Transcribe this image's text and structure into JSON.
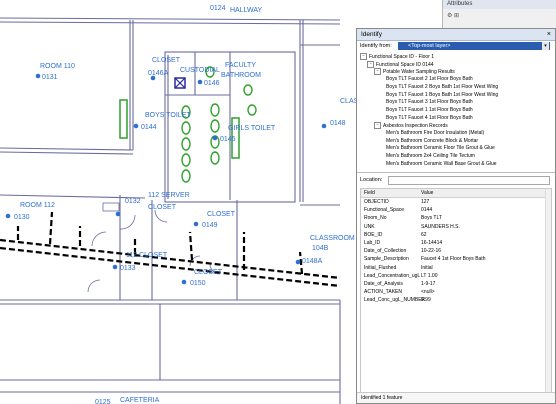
{
  "map": {
    "rooms": {
      "hallway_num": "0124",
      "hallway": "HALLWAY",
      "room110": "ROOM 110",
      "room110_num": "0131",
      "closet_a": "CLOSET",
      "closet_a_num": "0146A",
      "custodial": "CUSTODIAL",
      "faculty": "FACULTY",
      "bathroom": "BATHROOM",
      "bathroom_num": "0146",
      "boys_toilet": "BOYS TOILET",
      "boys_num": "0144",
      "girls_toilet": "GIRLS TOILET",
      "girls_num": "0145",
      "class_right": "CLASS",
      "class_right_num": "0148",
      "room112": "ROOM 112",
      "room112_num": "0130",
      "num0132": "0132",
      "server1": "112 SERVER",
      "server2": "CLOSET",
      "closet_b": "CLOSET",
      "closet_b_num": "0149",
      "closet_112": "112 CLOSET",
      "num0133": "0133",
      "closet_c": "CLOSET",
      "closet_c_num": "0150",
      "classroom": "CLASSROOM",
      "classroom_num": "104B",
      "classroom_num2": "0148A",
      "cafeteria": "CAFETERIA",
      "cafeteria_num": "0125"
    },
    "colors": {
      "walls": "#6b6b9e",
      "labels": "#2f6fd0",
      "plumbing": "#2ca02c",
      "pipe": "#000000"
    }
  },
  "attributes_panel": {
    "title": "Attributes",
    "toolbar": "⚙ ⊞"
  },
  "identify": {
    "title": "Identify",
    "close": "×",
    "from_label": "Identify from:",
    "from_value": "<Top-most layer>",
    "tree": [
      {
        "level": 0,
        "toggle": "−",
        "label": "Functional Space ID - Floor 1"
      },
      {
        "level": 1,
        "toggle": "−",
        "label": "Functional Space ID 0144"
      },
      {
        "level": 2,
        "toggle": "−",
        "label": "Potable Water Sampling Results"
      },
      {
        "level": 3,
        "toggle": "",
        "label": "Boys TLT Faucet 2 1st Floor Boys Bath"
      },
      {
        "level": 3,
        "toggle": "",
        "label": "Boys TLT Faucet 2 Boys Bath 1st Floor West Wing"
      },
      {
        "level": 3,
        "toggle": "",
        "label": "Boys TLT Faucet 1 Boys Bath 1st Floor West Wing"
      },
      {
        "level": 3,
        "toggle": "",
        "label": "Boys TLT Faucet 3 1st Floor Boys Bath"
      },
      {
        "level": 3,
        "toggle": "",
        "label": "Boys TLT Faucet 1 1st Floor Boys Bath"
      },
      {
        "level": 3,
        "toggle": "",
        "label": "Boys TLT Faucet 4 1st Floor Boys Bath"
      },
      {
        "level": 2,
        "toggle": "−",
        "label": "Asbestos Inspection Records"
      },
      {
        "level": 3,
        "toggle": "",
        "label": "Men's Bathroom Fire Door Insulation (Metal)"
      },
      {
        "level": 3,
        "toggle": "",
        "label": "Men's Bathroom Concrete Block & Mortar"
      },
      {
        "level": 3,
        "toggle": "",
        "label": "Men's Bathroom Ceramic Floor Tile Grout & Glue"
      },
      {
        "level": 3,
        "toggle": "",
        "label": "Men's Bathroom 2x4 Ceiling Tile Tectum"
      },
      {
        "level": 3,
        "toggle": "",
        "label": "Men's Bathroom Ceramic Wall Base Grout & Glue"
      }
    ],
    "location_label": "Location:",
    "grid_headers": {
      "field": "Field",
      "value": "Value"
    },
    "fields": [
      {
        "field": "OBJECTID",
        "value": "127"
      },
      {
        "field": "Functional_Space",
        "value": "0144"
      },
      {
        "field": "Room_No",
        "value": "Boys TLT"
      },
      {
        "field": "UNK",
        "value": "SAUNDERS H.S."
      },
      {
        "field": "BOE_ID",
        "value": "62"
      },
      {
        "field": "Lab_ID",
        "value": "16-14414"
      },
      {
        "field": "Date_of_Collection",
        "value": "10-22-16"
      },
      {
        "field": "Sample_Description",
        "value": "Faucet 4 1st Floor Boys Bath"
      },
      {
        "field": "Initial_Flushed",
        "value": "Initial"
      },
      {
        "field": "Lead_Concentration_ugL",
        "value": "LT 1.00"
      },
      {
        "field": "Date_of_Analysis",
        "value": "1-9-17"
      },
      {
        "field": "ACTION_TAKEN",
        "value": "<null>"
      },
      {
        "field": "Lead_Conc_ugL_NUMBER",
        "value": "0.99"
      }
    ],
    "status": "Identified 1 feature"
  }
}
